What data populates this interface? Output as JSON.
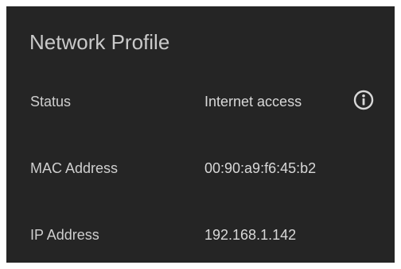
{
  "panel": {
    "title": "Network Profile"
  },
  "rows": [
    {
      "label": "Status",
      "value": "Internet access",
      "icon": "info-icon"
    },
    {
      "label": "MAC Address",
      "value": "00:90:a9:f6:45:b2"
    },
    {
      "label": "IP Address",
      "value": "192.168.1.142"
    }
  ],
  "colors": {
    "panel_background": "#252525",
    "text": "#d6d6d6"
  }
}
